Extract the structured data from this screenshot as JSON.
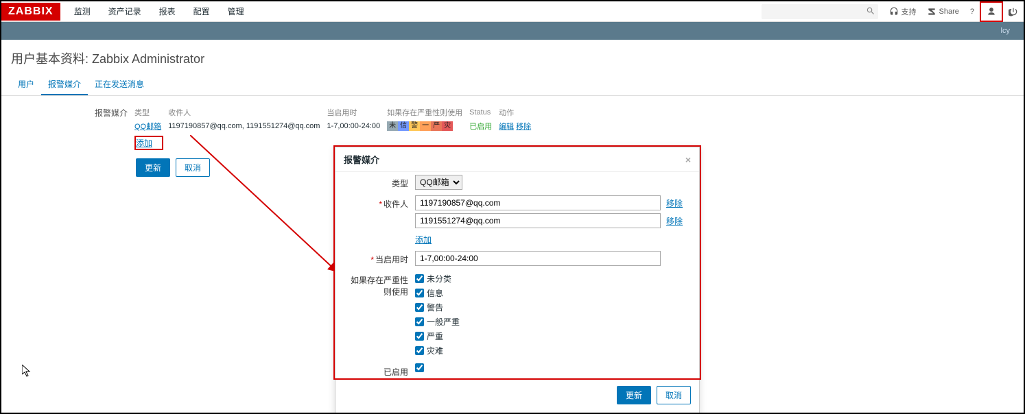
{
  "brand": "ZABBIX",
  "nav": {
    "items": [
      "监测",
      "资产记录",
      "报表",
      "配置",
      "管理"
    ]
  },
  "toprt": {
    "support": "支持",
    "share": "Share",
    "user_short": "lcy"
  },
  "title": "用户基本资料: Zabbix Administrator",
  "tabs": {
    "items": [
      "用户",
      "报警媒介",
      "正在发送消息"
    ],
    "activeIndex": 1
  },
  "media": {
    "section_label": "报警媒介",
    "cols": {
      "type": "类型",
      "recipients": "收件人",
      "when": "当启用时",
      "sev": "如果存在严重性则使用",
      "status": "Status",
      "actions": "动作"
    },
    "row": {
      "type": "QQ邮箱",
      "recipients": "1197190857@qq.com, 1191551274@qq.com",
      "when": "1-7,00:00-24:00",
      "sev_chars": [
        "未",
        "信",
        "警",
        "一",
        "严",
        "灾"
      ],
      "status": "已启用",
      "edit": "编辑",
      "remove": "移除"
    },
    "add": "添加"
  },
  "buttons": {
    "update": "更新",
    "cancel": "取消"
  },
  "modal": {
    "title": "报警媒介",
    "labels": {
      "type": "类型",
      "recipients": "收件人",
      "when": "当启用时",
      "sev": "如果存在严重性则使用",
      "enabled": "已启用"
    },
    "type_value": "QQ邮箱",
    "recipients": [
      "1197190857@qq.com",
      "1191551274@qq.com"
    ],
    "add": "添加",
    "remove": "移除",
    "when": "1-7,00:00-24:00",
    "sev_options": [
      "未分类",
      "信息",
      "警告",
      "一般严重",
      "严重",
      "灾难"
    ],
    "enabled": true,
    "update": "更新",
    "cancel": "取消"
  }
}
